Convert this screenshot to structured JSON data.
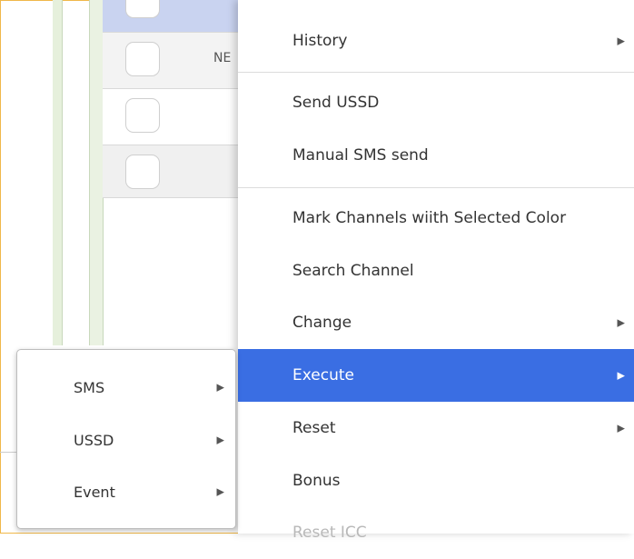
{
  "background": {
    "row_fragment_text": "NE"
  },
  "menu": {
    "items": [
      {
        "label": "History",
        "arrow": "▶"
      },
      {
        "label": "Send USSD"
      },
      {
        "label": "Manual SMS send"
      },
      {
        "label": "Mark Channels wiith Selected Color"
      },
      {
        "label": "Search Channel"
      },
      {
        "label": "Change",
        "arrow": "▶"
      },
      {
        "label": "Execute",
        "arrow": "▶"
      },
      {
        "label": "Reset",
        "arrow": "▶"
      },
      {
        "label": "Bonus"
      },
      {
        "label": "Reset ICC"
      }
    ]
  },
  "submenu": {
    "items": [
      {
        "label": "SMS",
        "arrow": "▶"
      },
      {
        "label": "USSD",
        "arrow": "▶"
      },
      {
        "label": "Event",
        "arrow": "▶"
      }
    ]
  },
  "colors": {
    "active_item": "#3a6ee3",
    "frame_border": "#f0b84a",
    "selected_row": "#c9d3f0"
  }
}
